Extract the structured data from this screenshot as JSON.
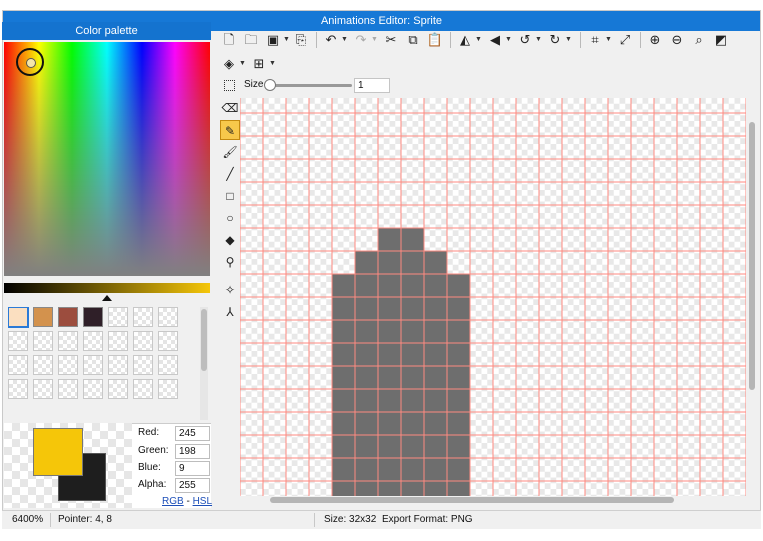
{
  "window": {
    "title": "Animations Editor: Sprite"
  },
  "palette": {
    "header": "Color palette",
    "swatches": [
      "#fbdfc0",
      "#d3924d",
      "#9c4d3e",
      "#2f1f28"
    ],
    "selected_swatch": 0,
    "empty_swatch_count": 24,
    "primary_color": "#f5c609",
    "secondary_color": "#1e1e1e",
    "channels": [
      {
        "label": "Red:",
        "value": "245"
      },
      {
        "label": "Green:",
        "value": "198"
      },
      {
        "label": "Blue:",
        "value": "9"
      },
      {
        "label": "Alpha:",
        "value": "255"
      }
    ],
    "mode_rgb": "RGB",
    "mode_sep": "-",
    "mode_hsl": "HSL"
  },
  "toolbar": {
    "new_icon": "new-document-icon",
    "open_icon": "open-folder-icon",
    "save_icon": "save-icon",
    "export_icon": "export-icon",
    "undo_icon": "undo-icon",
    "redo_icon": "redo-icon",
    "cut_icon": "cut-icon",
    "copy_icon": "copy-icon",
    "paste_icon": "paste-icon",
    "flip_h_icon": "flip-horizontal-icon",
    "flip_v_icon": "flip-vertical-icon",
    "rotate_ccw_icon": "rotate-ccw-icon",
    "rotate_cw_icon": "rotate-cw-icon",
    "crop_icon": "crop-icon",
    "resize_icon": "resize-icon",
    "zoom_in_icon": "zoom-in-icon",
    "zoom_out_icon": "zoom-out-icon",
    "zoom_fit_icon": "zoom-fit-icon",
    "invert_icon": "invert-icon",
    "layers_icon": "layers-icon",
    "grid_icon": "grid-icon"
  },
  "options": {
    "size_label": "Size",
    "size_value": "1",
    "size_slider_fraction": 0
  },
  "tools": [
    {
      "name": "eraser-icon",
      "active": false
    },
    {
      "name": "pencil-icon",
      "active": true
    },
    {
      "name": "brush-icon",
      "active": false
    },
    {
      "name": "line-icon",
      "active": false
    },
    {
      "name": "rectangle-icon",
      "active": false
    },
    {
      "name": "ellipse-icon",
      "active": false
    },
    {
      "name": "fill-bucket-icon",
      "active": false
    },
    {
      "name": "eyedropper-icon",
      "active": false
    },
    {
      "name": "move-icon",
      "active": false
    },
    {
      "name": "transform-icon",
      "active": false
    }
  ],
  "canvas": {
    "cols_visible": 22,
    "rows_visible": 18,
    "grid_color": "#ff8a80",
    "pixel_color": "#6e6e6e",
    "pixels": [
      [
        6,
        6
      ],
      [
        7,
        6
      ],
      [
        5,
        7
      ],
      [
        6,
        7
      ],
      [
        7,
        7
      ],
      [
        8,
        7
      ],
      [
        4,
        8
      ],
      [
        5,
        8
      ],
      [
        6,
        8
      ],
      [
        7,
        8
      ],
      [
        8,
        8
      ],
      [
        9,
        8
      ],
      [
        4,
        9
      ],
      [
        5,
        9
      ],
      [
        6,
        9
      ],
      [
        7,
        9
      ],
      [
        8,
        9
      ],
      [
        9,
        9
      ],
      [
        4,
        10
      ],
      [
        5,
        10
      ],
      [
        6,
        10
      ],
      [
        7,
        10
      ],
      [
        8,
        10
      ],
      [
        9,
        10
      ],
      [
        4,
        11
      ],
      [
        5,
        11
      ],
      [
        6,
        11
      ],
      [
        7,
        11
      ],
      [
        8,
        11
      ],
      [
        9,
        11
      ],
      [
        4,
        12
      ],
      [
        5,
        12
      ],
      [
        6,
        12
      ],
      [
        7,
        12
      ],
      [
        8,
        12
      ],
      [
        9,
        12
      ],
      [
        4,
        13
      ],
      [
        5,
        13
      ],
      [
        6,
        13
      ],
      [
        7,
        13
      ],
      [
        8,
        13
      ],
      [
        9,
        13
      ],
      [
        4,
        14
      ],
      [
        5,
        14
      ],
      [
        6,
        14
      ],
      [
        7,
        14
      ],
      [
        8,
        14
      ],
      [
        9,
        14
      ],
      [
        4,
        15
      ],
      [
        5,
        15
      ],
      [
        6,
        15
      ],
      [
        7,
        15
      ],
      [
        8,
        15
      ],
      [
        9,
        15
      ],
      [
        4,
        16
      ],
      [
        5,
        16
      ],
      [
        6,
        16
      ],
      [
        7,
        16
      ],
      [
        8,
        16
      ],
      [
        9,
        16
      ],
      [
        4,
        17
      ],
      [
        5,
        17
      ],
      [
        6,
        17
      ],
      [
        7,
        17
      ],
      [
        8,
        17
      ],
      [
        9,
        17
      ]
    ]
  },
  "status": {
    "zoom": "6400%",
    "pointer": "Pointer: 4, 8",
    "size": "Size: 32x32",
    "export_format": "Export Format: PNG"
  }
}
